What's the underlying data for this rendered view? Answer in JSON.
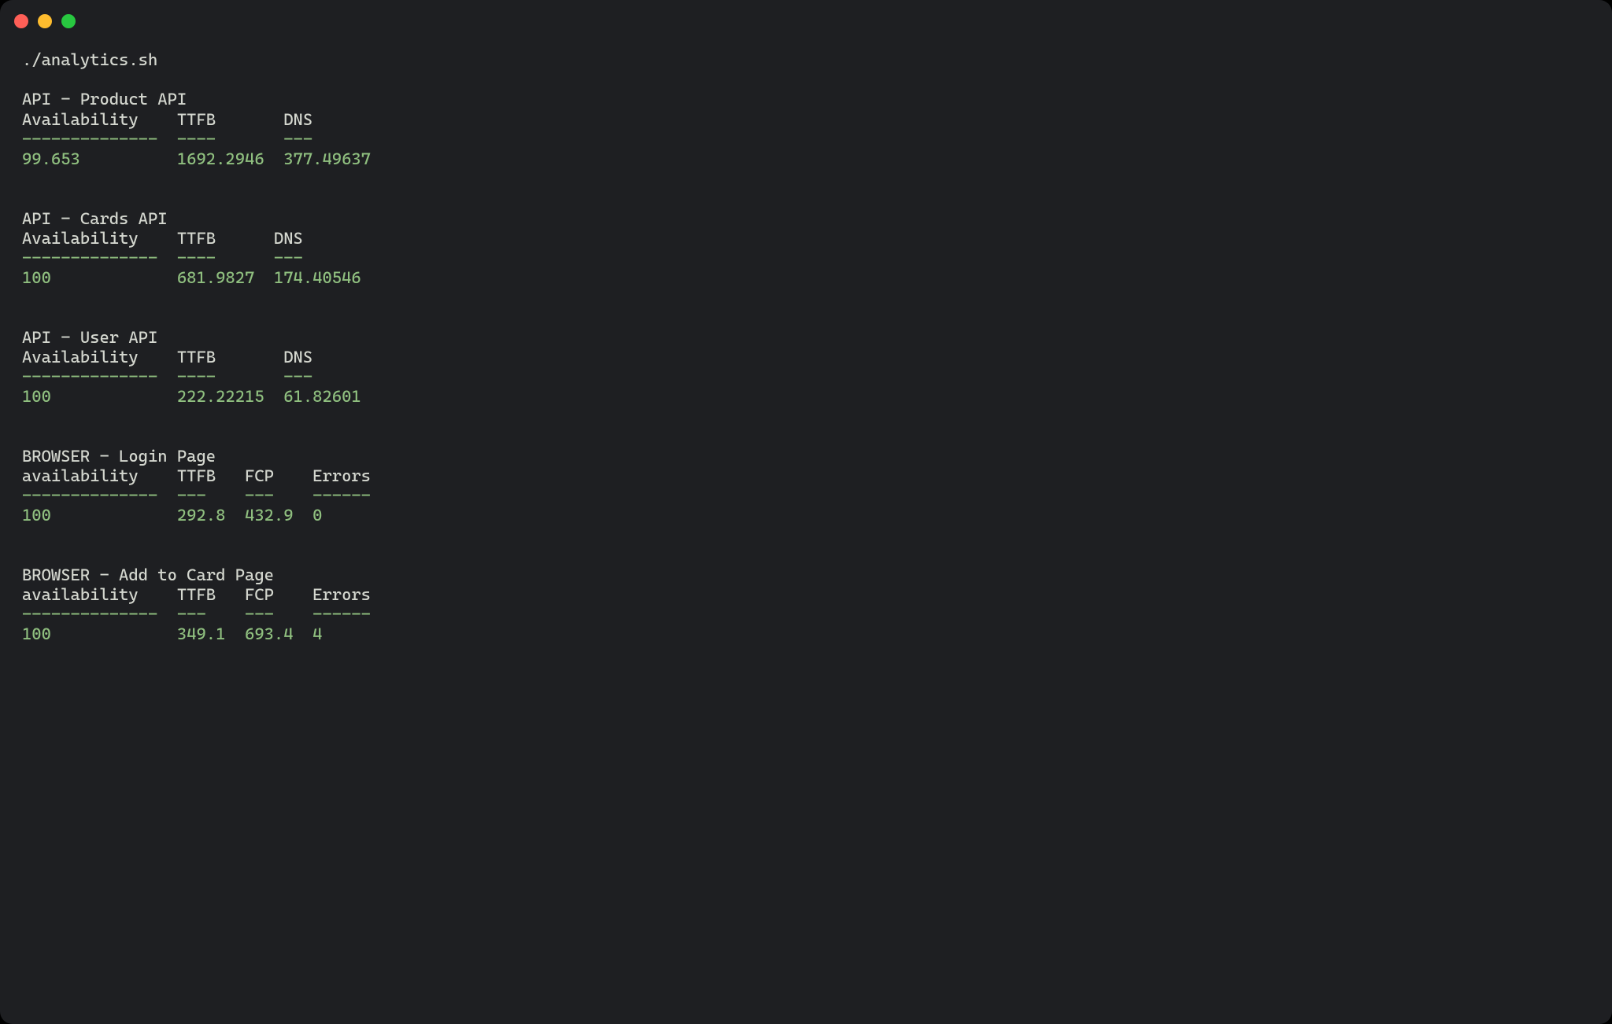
{
  "command": "./analytics.sh",
  "blocks": [
    {
      "title": "API - Product API",
      "headers": [
        "Availability",
        "TTFB",
        "DNS"
      ],
      "separators": [
        "--------------",
        "----",
        "---"
      ],
      "values": [
        "99.653",
        "1692.2946",
        "377.49637"
      ],
      "widths": [
        16,
        11,
        10
      ]
    },
    {
      "title": "API - Cards API",
      "headers": [
        "Availability",
        "TTFB",
        "DNS"
      ],
      "separators": [
        "--------------",
        "----",
        "---"
      ],
      "values": [
        "100",
        "681.9827",
        "174.40546"
      ],
      "widths": [
        16,
        10,
        10
      ]
    },
    {
      "title": "API - User API",
      "headers": [
        "Availability",
        "TTFB",
        "DNS"
      ],
      "separators": [
        "--------------",
        "----",
        "---"
      ],
      "values": [
        "100",
        "222.22215",
        "61.82601"
      ],
      "widths": [
        16,
        11,
        10
      ]
    },
    {
      "title": "BROWSER - Login Page",
      "headers": [
        "availability",
        "TTFB",
        "FCP",
        "Errors"
      ],
      "separators": [
        "--------------",
        "---",
        "---",
        "------"
      ],
      "values": [
        "100",
        "292.8",
        "432.9",
        "0"
      ],
      "widths": [
        16,
        7,
        7,
        7
      ]
    },
    {
      "title": "BROWSER - Add to Card Page",
      "headers": [
        "availability",
        "TTFB",
        "FCP",
        "Errors"
      ],
      "separators": [
        "--------------",
        "---",
        "---",
        "------"
      ],
      "values": [
        "100",
        "349.1",
        "693.4",
        "4"
      ],
      "widths": [
        16,
        7,
        7,
        7
      ]
    }
  ],
  "colors": {
    "bg": "#1e1f22",
    "text": "#d4d7cf",
    "accent": "#8fbf7f"
  }
}
